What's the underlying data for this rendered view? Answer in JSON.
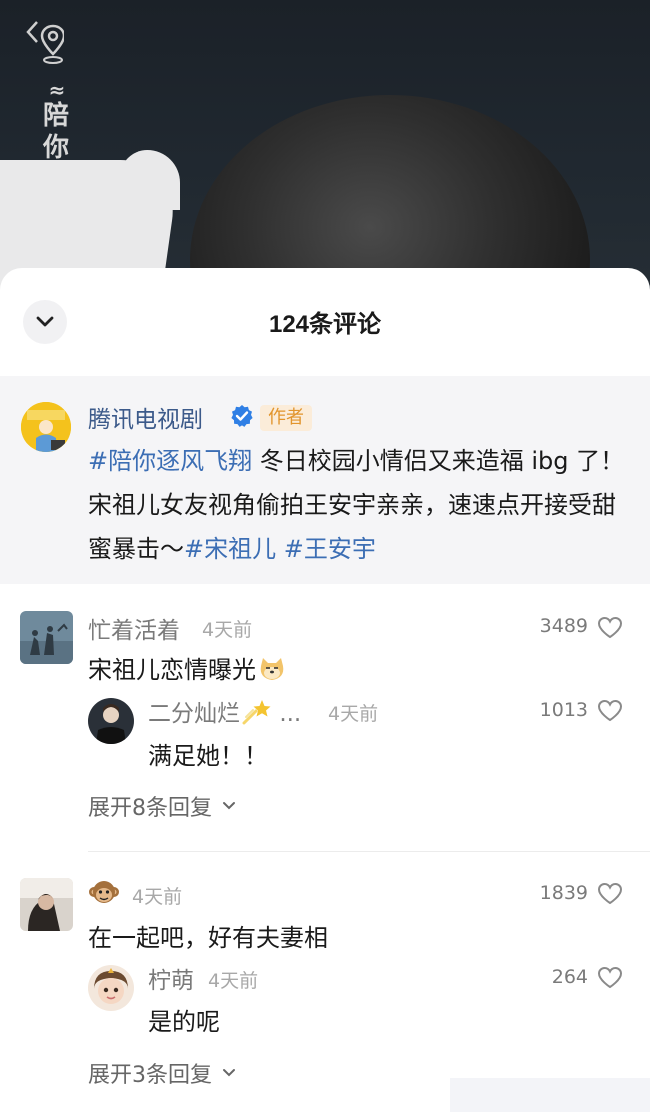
{
  "video": {
    "brand_text": "陪你",
    "icons": [
      "back-icon",
      "location-pin-icon"
    ]
  },
  "sheet": {
    "title": "124条评论",
    "collapse_icon": "chevron-down-icon"
  },
  "author_post": {
    "name": "腾讯电视剧",
    "verified_icon": "verified-badge-icon",
    "tag": "作者",
    "hashtag_main": "#陪你逐风飞翔",
    "text": " 冬日校园小情侣又来造福 ibg 了！宋祖儿女友视角偷拍王安宇亲亲，速速点开接受甜蜜暴击～",
    "hashtag_1": "#宋祖儿",
    "hashtag_2": "#王安宇"
  },
  "comments": [
    {
      "name": "忙着活着",
      "time": "4天前",
      "likes": "3489",
      "text": "宋祖儿恋情曝光",
      "emoji": "doge-emoji-icon",
      "reply": {
        "name": "二分灿烂",
        "emoji": "shooting-star-emoji-icon",
        "ellipsis": "...",
        "time": "4天前",
        "likes": "1013",
        "text": "满足她！！"
      },
      "expand": "展开8条回复"
    },
    {
      "name_emoji": "monkey-emoji-icon",
      "time": "4天前",
      "likes": "1839",
      "text": "在一起吧，好有夫妻相",
      "reply": {
        "name": "柠萌",
        "time": "4天前",
        "likes": "264",
        "text": "是的呢"
      },
      "expand": "展开3条回复"
    }
  ],
  "colors": {
    "hashtag": "#3c6eb4",
    "author_name": "#3c5a8a",
    "author_tag": "#e2952d",
    "author_bg": "#f5f5f7"
  }
}
